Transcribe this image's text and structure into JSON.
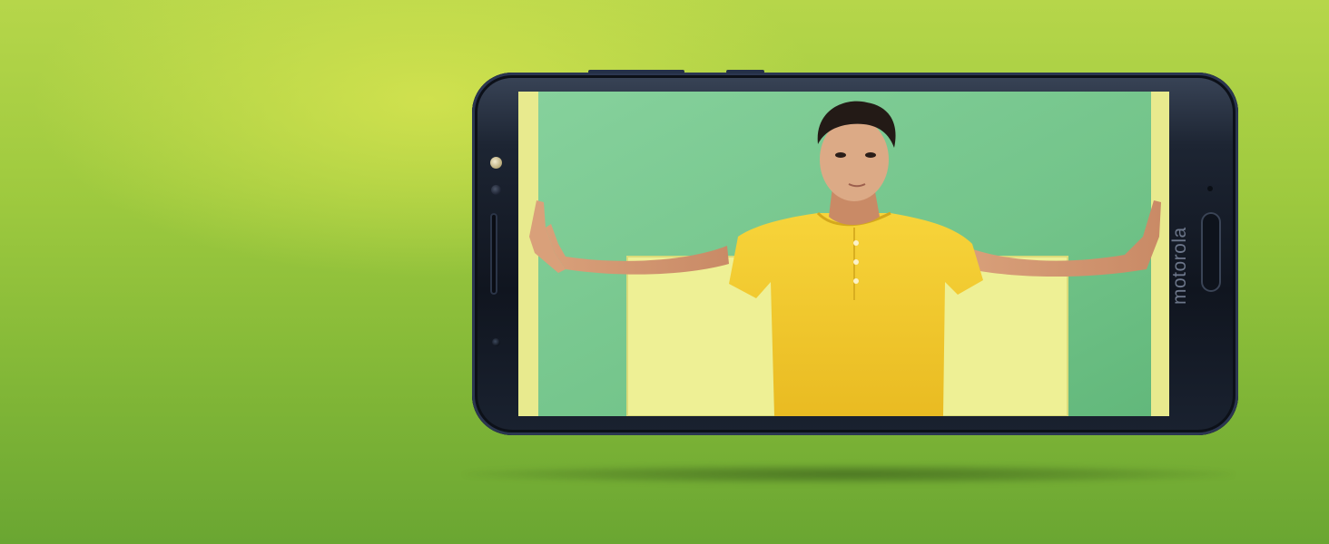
{
  "phone": {
    "brand_text": "motorola"
  },
  "colors": {
    "background_top": "#b6d64a",
    "background_bottom": "#6aa632",
    "phone_body": "#10151f",
    "screen_wall": "#79c68d",
    "paper": "#e9ec8d",
    "shirt": "#f0c72a"
  }
}
